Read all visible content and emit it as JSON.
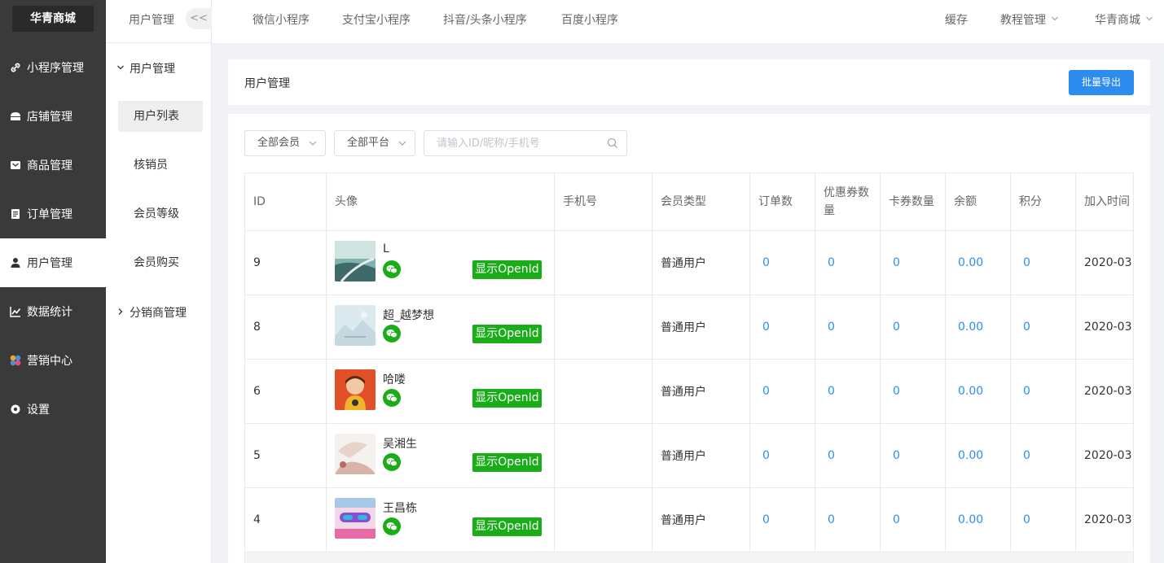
{
  "sidebar": {
    "brand": "华青商城",
    "items": [
      {
        "label": "小程序管理",
        "icon": "link-icon"
      },
      {
        "label": "店铺管理",
        "icon": "shop-icon"
      },
      {
        "label": "商品管理",
        "icon": "goods-icon"
      },
      {
        "label": "订单管理",
        "icon": "order-icon"
      },
      {
        "label": "用户管理",
        "icon": "user-icon",
        "active": true
      },
      {
        "label": "数据统计",
        "icon": "chart-icon"
      },
      {
        "label": "营销中心",
        "icon": "marketing-icon"
      },
      {
        "label": "设置",
        "icon": "gear-icon"
      }
    ]
  },
  "subbar": {
    "title": "用户管理",
    "collapse": "<<",
    "group1": "用户管理",
    "items": [
      "用户列表",
      "核销员",
      "会员等级",
      "会员购买"
    ],
    "group2": "分销商管理"
  },
  "topbar": {
    "tabs": [
      "微信小程序",
      "支付宝小程序",
      "抖音/头条小程序",
      "百度小程序"
    ],
    "cache": "缓存",
    "tutorial": "教程管理",
    "store": "华青商城"
  },
  "header": {
    "title": "用户管理",
    "export": "批量导出"
  },
  "filters": {
    "member": "全部会员",
    "platform": "全部平台",
    "search_placeholder": "请输入ID/昵称/手机号"
  },
  "table": {
    "columns": [
      "ID",
      "头像",
      "手机号",
      "会员类型",
      "订单数",
      "优惠券数量",
      "卡券数量",
      "余额",
      "积分",
      "加入时间"
    ],
    "openid_label": "显示OpenId",
    "rows": [
      {
        "id": "9",
        "nick": "L",
        "phone": "",
        "type": "普通用户",
        "orders": "0",
        "coupons": "0",
        "cards": "0",
        "balance": "0.00",
        "points": "0",
        "joined": "2020-03"
      },
      {
        "id": "8",
        "nick": "超_越梦想",
        "phone": "",
        "type": "普通用户",
        "orders": "0",
        "coupons": "0",
        "cards": "0",
        "balance": "0.00",
        "points": "0",
        "joined": "2020-03"
      },
      {
        "id": "6",
        "nick": "哈喽",
        "phone": "",
        "type": "普通用户",
        "orders": "0",
        "coupons": "0",
        "cards": "0",
        "balance": "0.00",
        "points": "0",
        "joined": "2020-03"
      },
      {
        "id": "5",
        "nick": "吴湘生",
        "phone": "",
        "type": "普通用户",
        "orders": "0",
        "coupons": "0",
        "cards": "0",
        "balance": "0.00",
        "points": "0",
        "joined": "2020-03"
      },
      {
        "id": "4",
        "nick": "王昌栋",
        "phone": "",
        "type": "普通用户",
        "orders": "0",
        "coupons": "0",
        "cards": "0",
        "balance": "0.00",
        "points": "0",
        "joined": "2020-03"
      }
    ]
  }
}
